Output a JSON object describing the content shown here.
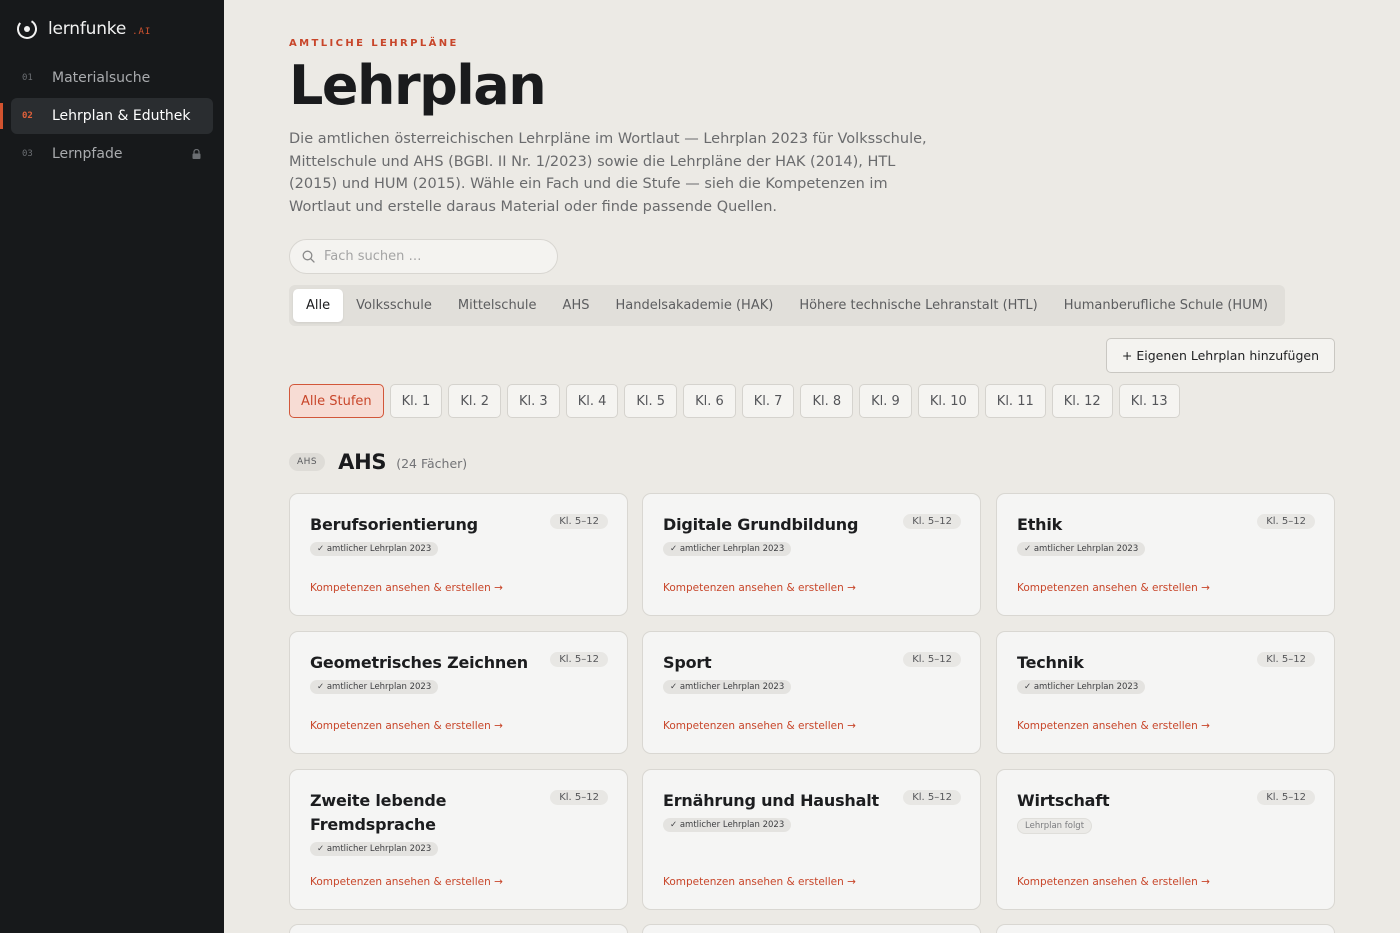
{
  "sidebar": {
    "brand": {
      "name": "lernfunke",
      "suffix": ".AI"
    },
    "items": [
      {
        "num": "01",
        "label": "Materialsuche",
        "active": false,
        "locked": false
      },
      {
        "num": "02",
        "label": "Lehrplan & Eduthek",
        "active": true,
        "locked": false
      },
      {
        "num": "03",
        "label": "Lernpfade",
        "active": false,
        "locked": true
      }
    ]
  },
  "header": {
    "eyebrow": "AMTLICHE LEHRPLÄNE",
    "title": "Lehrplan",
    "intro": "Die amtlichen österreichischen Lehrpläne im Wortlaut — Lehrplan 2023 für Volksschule, Mittelschule und AHS (BGBl. II Nr. 1/2023) sowie die Lehrpläne der HAK (2014), HTL (2015) und HUM (2015). Wähle ein Fach und die Stufe — sieh die Kompetenzen im Wortlaut und erstelle daraus Material oder finde passende Quellen."
  },
  "search": {
    "placeholder": "Fach suchen …",
    "value": ""
  },
  "school_tabs": [
    {
      "label": "Alle",
      "active": true
    },
    {
      "label": "Volksschule",
      "active": false
    },
    {
      "label": "Mittelschule",
      "active": false
    },
    {
      "label": "AHS",
      "active": false
    },
    {
      "label": "Handelsakademie (HAK)",
      "active": false
    },
    {
      "label": "Höhere technische Lehranstalt (HTL)",
      "active": false
    },
    {
      "label": "Humanberufliche Schule (HUM)",
      "active": false
    }
  ],
  "add_button": {
    "label": "+ Eigenen Lehrplan hinzufügen"
  },
  "grade_filters": [
    {
      "label": "Alle Stufen",
      "active": true
    },
    {
      "label": "Kl. 1",
      "active": false
    },
    {
      "label": "Kl. 2",
      "active": false
    },
    {
      "label": "Kl. 3",
      "active": false
    },
    {
      "label": "Kl. 4",
      "active": false
    },
    {
      "label": "Kl. 5",
      "active": false
    },
    {
      "label": "Kl. 6",
      "active": false
    },
    {
      "label": "Kl. 7",
      "active": false
    },
    {
      "label": "Kl. 8",
      "active": false
    },
    {
      "label": "Kl. 9",
      "active": false
    },
    {
      "label": "Kl. 10",
      "active": false
    },
    {
      "label": "Kl. 11",
      "active": false
    },
    {
      "label": "Kl. 12",
      "active": false
    },
    {
      "label": "Kl. 13",
      "active": false
    }
  ],
  "section": {
    "tag": "AHS",
    "title": "AHS",
    "count": "(24 Fächer)"
  },
  "cards": [
    {
      "title": "Berufsorientierung",
      "range": "Kl. 5–12",
      "badge": "✓ amtlicher Lehrplan 2023",
      "pending": false,
      "link": "Kompetenzen ansehen & erstellen →"
    },
    {
      "title": "Digitale Grundbildung",
      "range": "Kl. 5–12",
      "badge": "✓ amtlicher Lehrplan 2023",
      "pending": false,
      "link": "Kompetenzen ansehen & erstellen →"
    },
    {
      "title": "Ethik",
      "range": "Kl. 5–12",
      "badge": "✓ amtlicher Lehrplan 2023",
      "pending": false,
      "link": "Kompetenzen ansehen & erstellen →"
    },
    {
      "title": "Geometrisches Zeichnen",
      "range": "Kl. 5–12",
      "badge": "✓ amtlicher Lehrplan 2023",
      "pending": false,
      "link": "Kompetenzen ansehen & erstellen →"
    },
    {
      "title": "Sport",
      "range": "Kl. 5–12",
      "badge": "✓ amtlicher Lehrplan 2023",
      "pending": false,
      "link": "Kompetenzen ansehen & erstellen →"
    },
    {
      "title": "Technik",
      "range": "Kl. 5–12",
      "badge": "✓ amtlicher Lehrplan 2023",
      "pending": false,
      "link": "Kompetenzen ansehen & erstellen →"
    },
    {
      "title": "Zweite lebende Fremdsprache",
      "range": "Kl. 5–12",
      "badge": "✓ amtlicher Lehrplan 2023",
      "pending": false,
      "link": "Kompetenzen ansehen & erstellen →"
    },
    {
      "title": "Ernährung und Haushalt",
      "range": "Kl. 5–12",
      "badge": "✓ amtlicher Lehrplan 2023",
      "pending": false,
      "link": "Kompetenzen ansehen & erstellen →"
    },
    {
      "title": "Wirtschaft",
      "range": "Kl. 5–12",
      "badge": "Lehrplan folgt",
      "pending": true,
      "link": "Kompetenzen ansehen & erstellen →"
    }
  ]
}
